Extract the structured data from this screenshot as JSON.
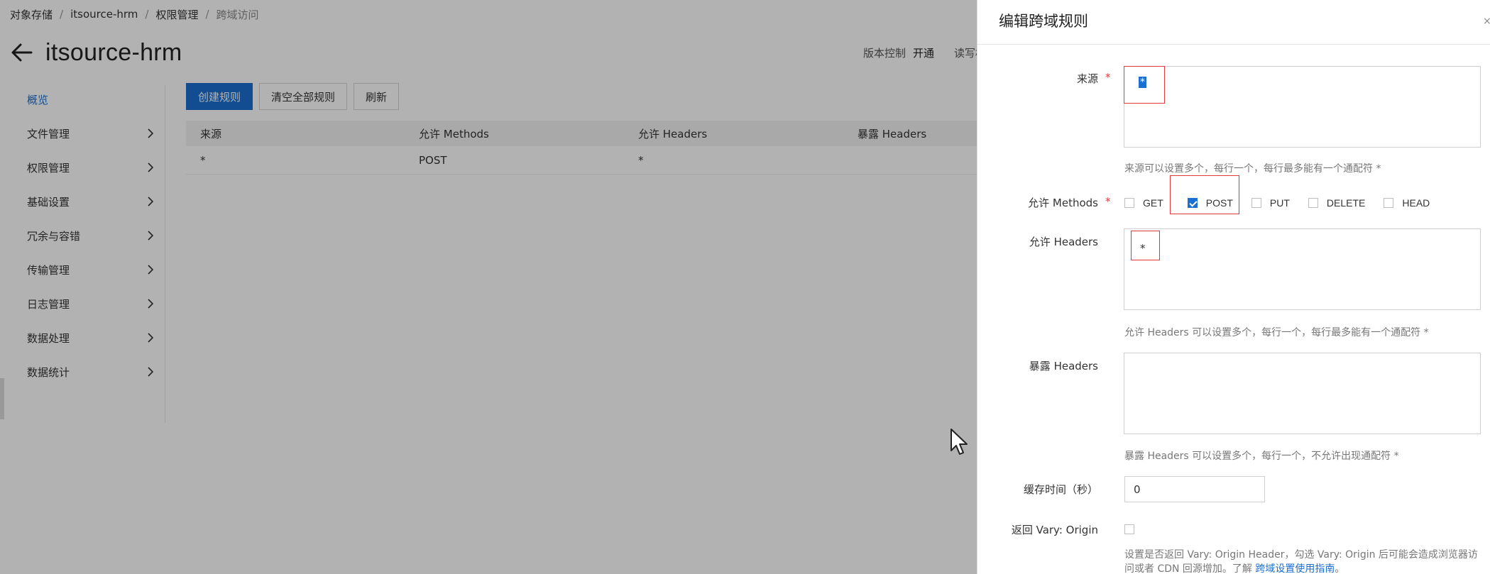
{
  "breadcrumb": [
    "对象存储",
    "itsource-hrm",
    "权限管理",
    "跨域访问"
  ],
  "page": {
    "title": "itsource-hrm",
    "header_items": [
      {
        "label": "版本控制",
        "value": "开通"
      },
      {
        "label": "读写权"
      }
    ]
  },
  "sidebar": {
    "items": [
      {
        "label": "概览",
        "active": true
      },
      {
        "label": "文件管理"
      },
      {
        "label": "权限管理"
      },
      {
        "label": "基础设置"
      },
      {
        "label": "冗余与容错"
      },
      {
        "label": "传输管理"
      },
      {
        "label": "日志管理"
      },
      {
        "label": "数据处理"
      },
      {
        "label": "数据统计"
      }
    ]
  },
  "toolbar": {
    "create": "创建规则",
    "clear": "清空全部规则",
    "refresh": "刷新"
  },
  "table": {
    "columns": [
      "来源",
      "允许 Methods",
      "允许 Headers",
      "暴露 Headers"
    ],
    "rows": [
      [
        "*",
        "POST",
        "*",
        ""
      ]
    ]
  },
  "drawer": {
    "title": "编辑跨域规则",
    "close_icon": "close-icon",
    "origin": {
      "label": "来源",
      "required": "*",
      "value": "*",
      "hint": "来源可以设置多个，每行一个，每行最多能有一个通配符 *"
    },
    "methods": {
      "label": "允许 Methods",
      "required": "*",
      "options": [
        {
          "name": "GET",
          "checked": false
        },
        {
          "name": "POST",
          "checked": true
        },
        {
          "name": "PUT",
          "checked": false
        },
        {
          "name": "DELETE",
          "checked": false
        },
        {
          "name": "HEAD",
          "checked": false
        }
      ]
    },
    "allow_headers": {
      "label": "允许 Headers",
      "value": "*",
      "hint": "允许 Headers 可以设置多个，每行一个，每行最多能有一个通配符 *"
    },
    "expose_headers": {
      "label": "暴露 Headers",
      "value": "",
      "hint": "暴露 Headers 可以设置多个，每行一个，不允许出现通配符 *"
    },
    "cache": {
      "label": "缓存时间（秒）",
      "value": "0"
    },
    "vary": {
      "label": "返回 Vary: Origin",
      "checked": false
    },
    "vary_desc": "设置是否返回 Vary: Origin Header，勾选 Vary: Origin 后可能会造成浏览器访问或者 CDN 回源增加。了解",
    "vary_link": "跨域设置使用指南",
    "vary_desc_end": "。"
  },
  "colors": {
    "primary": "#1a6fd1",
    "required": "#e4393c",
    "annotation": "#e4393c"
  }
}
